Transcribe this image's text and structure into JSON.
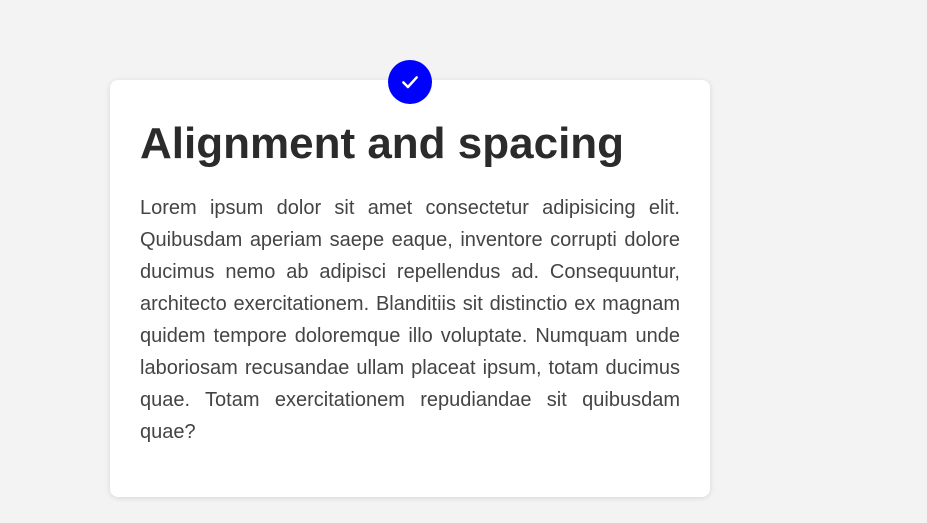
{
  "card": {
    "title": "Alignment and spacing",
    "body": "Lorem ipsum dolor sit amet consectetur adipisicing elit. Quibusdam aperiam saepe eaque, inventore corrupti dolore ducimus nemo ab adipisci repellendus ad. Consequuntur, architecto exercitationem. Blanditiis sit distinctio ex magnam quidem tempore doloremque illo voluptate. Numquam unde laboriosam recusandae ullam placeat ipsum, totam ducimus quae. Totam exercitationem repudiandae sit quibusdam quae?",
    "badge_icon": "check-icon",
    "badge_color": "#0000ff"
  },
  "colors": {
    "page_background": "#f3f3f3",
    "card_background": "#ffffff",
    "title_text": "#2b2b2b",
    "body_text": "#444444"
  }
}
